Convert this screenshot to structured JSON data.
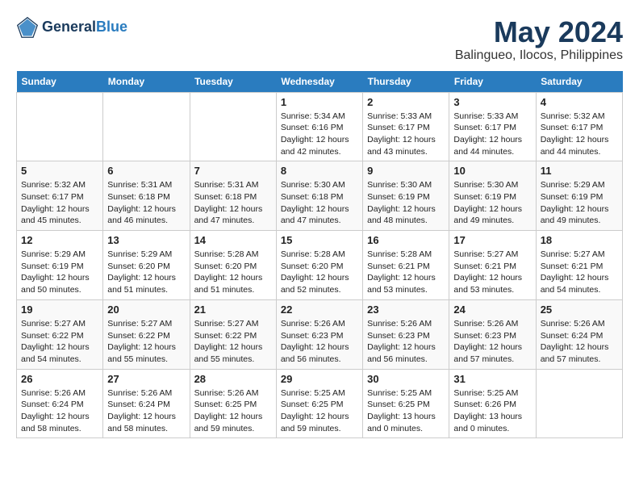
{
  "header": {
    "logo_line1": "General",
    "logo_line2": "Blue",
    "month": "May 2024",
    "location": "Balingueo, Ilocos, Philippines"
  },
  "weekdays": [
    "Sunday",
    "Monday",
    "Tuesday",
    "Wednesday",
    "Thursday",
    "Friday",
    "Saturday"
  ],
  "weeks": [
    [
      {
        "day": "",
        "info": ""
      },
      {
        "day": "",
        "info": ""
      },
      {
        "day": "",
        "info": ""
      },
      {
        "day": "1",
        "info": "Sunrise: 5:34 AM\nSunset: 6:16 PM\nDaylight: 12 hours\nand 42 minutes."
      },
      {
        "day": "2",
        "info": "Sunrise: 5:33 AM\nSunset: 6:17 PM\nDaylight: 12 hours\nand 43 minutes."
      },
      {
        "day": "3",
        "info": "Sunrise: 5:33 AM\nSunset: 6:17 PM\nDaylight: 12 hours\nand 44 minutes."
      },
      {
        "day": "4",
        "info": "Sunrise: 5:32 AM\nSunset: 6:17 PM\nDaylight: 12 hours\nand 44 minutes."
      }
    ],
    [
      {
        "day": "5",
        "info": "Sunrise: 5:32 AM\nSunset: 6:17 PM\nDaylight: 12 hours\nand 45 minutes."
      },
      {
        "day": "6",
        "info": "Sunrise: 5:31 AM\nSunset: 6:18 PM\nDaylight: 12 hours\nand 46 minutes."
      },
      {
        "day": "7",
        "info": "Sunrise: 5:31 AM\nSunset: 6:18 PM\nDaylight: 12 hours\nand 47 minutes."
      },
      {
        "day": "8",
        "info": "Sunrise: 5:30 AM\nSunset: 6:18 PM\nDaylight: 12 hours\nand 47 minutes."
      },
      {
        "day": "9",
        "info": "Sunrise: 5:30 AM\nSunset: 6:19 PM\nDaylight: 12 hours\nand 48 minutes."
      },
      {
        "day": "10",
        "info": "Sunrise: 5:30 AM\nSunset: 6:19 PM\nDaylight: 12 hours\nand 49 minutes."
      },
      {
        "day": "11",
        "info": "Sunrise: 5:29 AM\nSunset: 6:19 PM\nDaylight: 12 hours\nand 49 minutes."
      }
    ],
    [
      {
        "day": "12",
        "info": "Sunrise: 5:29 AM\nSunset: 6:19 PM\nDaylight: 12 hours\nand 50 minutes."
      },
      {
        "day": "13",
        "info": "Sunrise: 5:29 AM\nSunset: 6:20 PM\nDaylight: 12 hours\nand 51 minutes."
      },
      {
        "day": "14",
        "info": "Sunrise: 5:28 AM\nSunset: 6:20 PM\nDaylight: 12 hours\nand 51 minutes."
      },
      {
        "day": "15",
        "info": "Sunrise: 5:28 AM\nSunset: 6:20 PM\nDaylight: 12 hours\nand 52 minutes."
      },
      {
        "day": "16",
        "info": "Sunrise: 5:28 AM\nSunset: 6:21 PM\nDaylight: 12 hours\nand 53 minutes."
      },
      {
        "day": "17",
        "info": "Sunrise: 5:27 AM\nSunset: 6:21 PM\nDaylight: 12 hours\nand 53 minutes."
      },
      {
        "day": "18",
        "info": "Sunrise: 5:27 AM\nSunset: 6:21 PM\nDaylight: 12 hours\nand 54 minutes."
      }
    ],
    [
      {
        "day": "19",
        "info": "Sunrise: 5:27 AM\nSunset: 6:22 PM\nDaylight: 12 hours\nand 54 minutes."
      },
      {
        "day": "20",
        "info": "Sunrise: 5:27 AM\nSunset: 6:22 PM\nDaylight: 12 hours\nand 55 minutes."
      },
      {
        "day": "21",
        "info": "Sunrise: 5:27 AM\nSunset: 6:22 PM\nDaylight: 12 hours\nand 55 minutes."
      },
      {
        "day": "22",
        "info": "Sunrise: 5:26 AM\nSunset: 6:23 PM\nDaylight: 12 hours\nand 56 minutes."
      },
      {
        "day": "23",
        "info": "Sunrise: 5:26 AM\nSunset: 6:23 PM\nDaylight: 12 hours\nand 56 minutes."
      },
      {
        "day": "24",
        "info": "Sunrise: 5:26 AM\nSunset: 6:23 PM\nDaylight: 12 hours\nand 57 minutes."
      },
      {
        "day": "25",
        "info": "Sunrise: 5:26 AM\nSunset: 6:24 PM\nDaylight: 12 hours\nand 57 minutes."
      }
    ],
    [
      {
        "day": "26",
        "info": "Sunrise: 5:26 AM\nSunset: 6:24 PM\nDaylight: 12 hours\nand 58 minutes."
      },
      {
        "day": "27",
        "info": "Sunrise: 5:26 AM\nSunset: 6:24 PM\nDaylight: 12 hours\nand 58 minutes."
      },
      {
        "day": "28",
        "info": "Sunrise: 5:26 AM\nSunset: 6:25 PM\nDaylight: 12 hours\nand 59 minutes."
      },
      {
        "day": "29",
        "info": "Sunrise: 5:25 AM\nSunset: 6:25 PM\nDaylight: 12 hours\nand 59 minutes."
      },
      {
        "day": "30",
        "info": "Sunrise: 5:25 AM\nSunset: 6:25 PM\nDaylight: 13 hours\nand 0 minutes."
      },
      {
        "day": "31",
        "info": "Sunrise: 5:25 AM\nSunset: 6:26 PM\nDaylight: 13 hours\nand 0 minutes."
      },
      {
        "day": "",
        "info": ""
      }
    ]
  ]
}
